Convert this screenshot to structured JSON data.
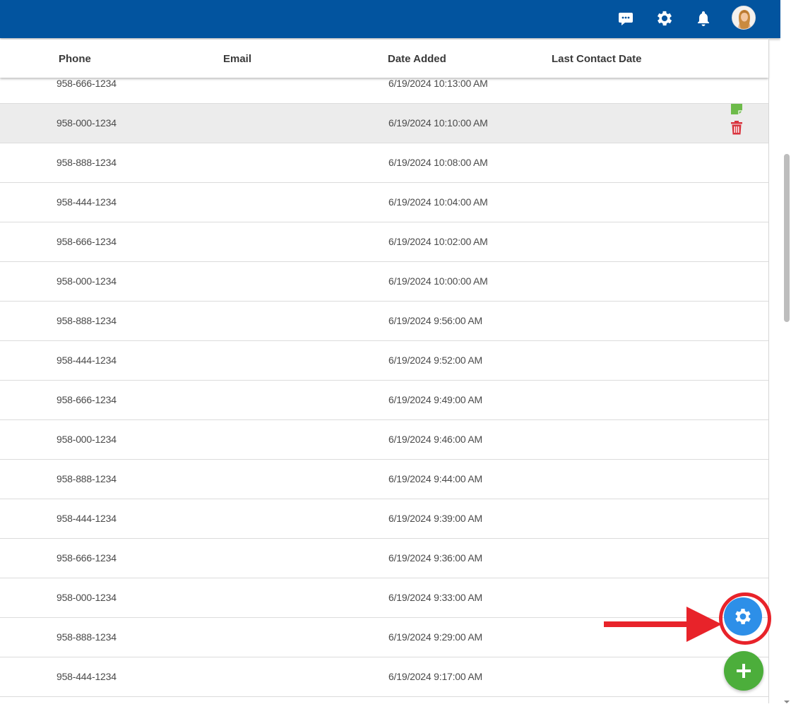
{
  "topbar": {
    "icons": [
      "chat-icon",
      "gear-icon",
      "bell-icon",
      "avatar"
    ],
    "color": "#02549f"
  },
  "table": {
    "columns": [
      "Phone",
      "Email",
      "Date Added",
      "Last Contact Date"
    ],
    "rows": [
      {
        "phone": "958-666-1234",
        "email": "",
        "date_added": "6/19/2024 10:13:00 AM",
        "last_contact": ""
      },
      {
        "phone": "958-000-1234",
        "email": "",
        "date_added": "6/19/2024 10:10:00 AM",
        "last_contact": ""
      },
      {
        "phone": "958-888-1234",
        "email": "",
        "date_added": "6/19/2024 10:08:00 AM",
        "last_contact": ""
      },
      {
        "phone": "958-444-1234",
        "email": "",
        "date_added": "6/19/2024 10:04:00 AM",
        "last_contact": ""
      },
      {
        "phone": "958-666-1234",
        "email": "",
        "date_added": "6/19/2024 10:02:00 AM",
        "last_contact": ""
      },
      {
        "phone": "958-000-1234",
        "email": "",
        "date_added": "6/19/2024 10:00:00 AM",
        "last_contact": ""
      },
      {
        "phone": "958-888-1234",
        "email": "",
        "date_added": "6/19/2024 9:56:00 AM",
        "last_contact": ""
      },
      {
        "phone": "958-444-1234",
        "email": "",
        "date_added": "6/19/2024 9:52:00 AM",
        "last_contact": ""
      },
      {
        "phone": "958-666-1234",
        "email": "",
        "date_added": "6/19/2024 9:49:00 AM",
        "last_contact": ""
      },
      {
        "phone": "958-000-1234",
        "email": "",
        "date_added": "6/19/2024 9:46:00 AM",
        "last_contact": ""
      },
      {
        "phone": "958-888-1234",
        "email": "",
        "date_added": "6/19/2024 9:44:00 AM",
        "last_contact": ""
      },
      {
        "phone": "958-444-1234",
        "email": "",
        "date_added": "6/19/2024 9:39:00 AM",
        "last_contact": ""
      },
      {
        "phone": "958-666-1234",
        "email": "",
        "date_added": "6/19/2024 9:36:00 AM",
        "last_contact": ""
      },
      {
        "phone": "958-000-1234",
        "email": "",
        "date_added": "6/19/2024 9:33:00 AM",
        "last_contact": ""
      },
      {
        "phone": "958-888-1234",
        "email": "",
        "date_added": "6/19/2024 9:29:00 AM",
        "last_contact": ""
      },
      {
        "phone": "958-444-1234",
        "email": "",
        "date_added": "6/19/2024 9:17:00 AM",
        "last_contact": ""
      }
    ],
    "hovered_row": 1,
    "row_action_icons": [
      "edit-note-icon",
      "trash-icon"
    ]
  },
  "fabs": {
    "settings_icon": "gear-icon",
    "settings_color": "#2d8fe8",
    "add_icon": "plus-icon",
    "add_color": "#4cae3b",
    "annotation_color": "#e8232a"
  }
}
